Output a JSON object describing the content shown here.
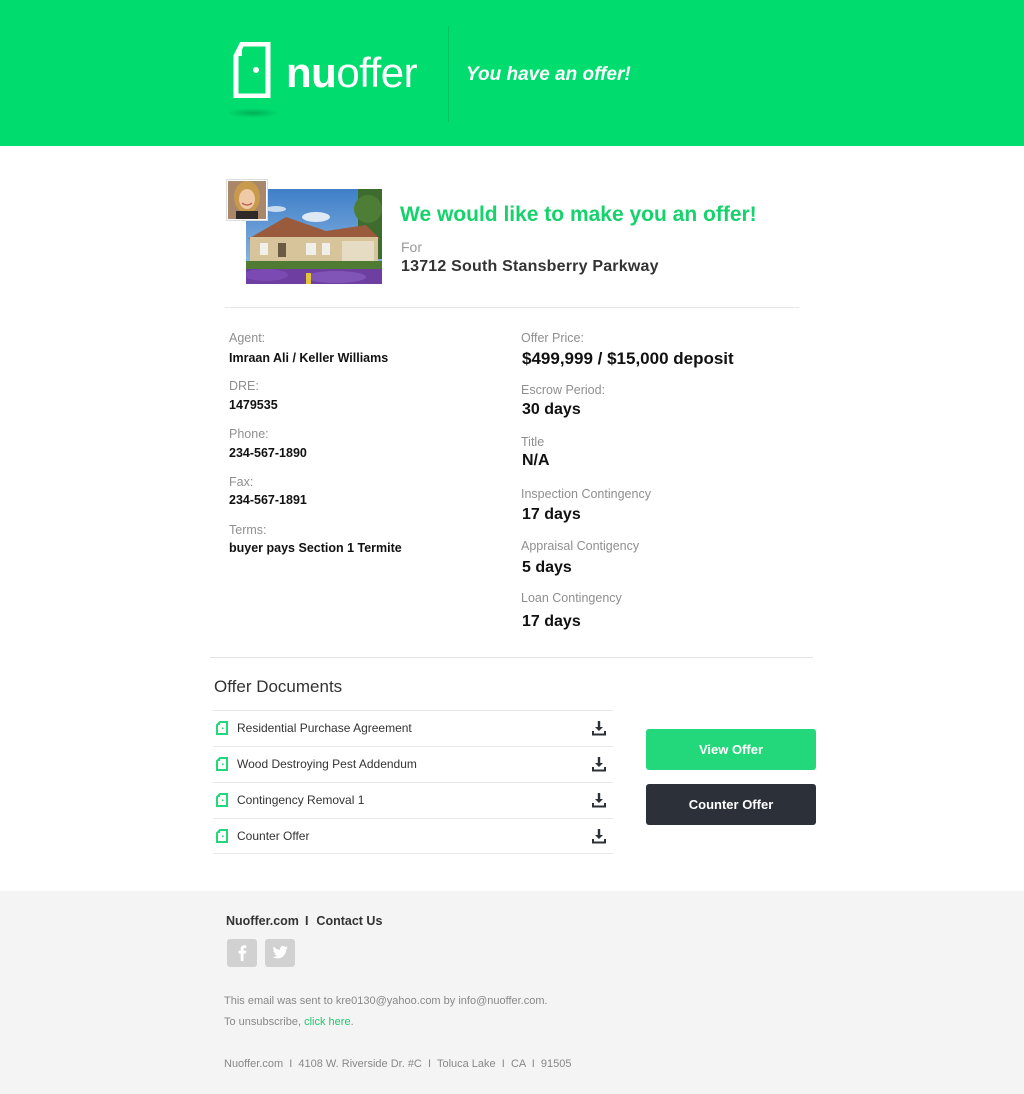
{
  "header": {
    "logo_bold": "nu",
    "logo_light": "offer",
    "tagline": "You have an offer!",
    "brand_color": "#00dd6e"
  },
  "hero": {
    "title": "We would like to make you an offer!",
    "for_label": "For",
    "address": "13712 South Stansberry Parkway"
  },
  "details": {
    "left": [
      {
        "label": "Agent:",
        "value": "Imraan Ali / Keller Williams"
      },
      {
        "label": "DRE:",
        "value": "1479535"
      },
      {
        "label": "Phone:",
        "value": "234-567-1890"
      },
      {
        "label": "Fax:",
        "value": "234-567-1891"
      },
      {
        "label": "Terms:",
        "value": "buyer pays Section 1 Termite"
      }
    ],
    "right": [
      {
        "label": "Offer Price:",
        "value": "$499,999 / $15,000 deposit"
      },
      {
        "label": "Escrow Period:",
        "value": "30 days"
      },
      {
        "label": "Title",
        "value": "N/A"
      },
      {
        "label": "Inspection Contingency",
        "value": "17 days"
      },
      {
        "label": "Appraisal Contigency",
        "value": "5 days"
      },
      {
        "label": "Loan Contingency",
        "value": "17 days"
      }
    ]
  },
  "documents": {
    "title": "Offer Documents",
    "items": [
      {
        "name": "Residential Purchase Agreement",
        "icon": "document-icon",
        "action": "download-icon"
      },
      {
        "name": "Wood Destroying Pest Addendum",
        "icon": "document-icon",
        "action": "download-icon"
      },
      {
        "name": "Contingency Removal 1",
        "icon": "document-icon",
        "action": "download-icon"
      },
      {
        "name": "Counter Offer",
        "icon": "document-icon",
        "action": "download-icon"
      }
    ]
  },
  "actions": {
    "view_offer": "View Offer",
    "counter_offer": "Counter Offer",
    "view_color": "#23d87a",
    "counter_color": "#2c3038"
  },
  "footer": {
    "link_site": "Nuoffer.com",
    "separator": "I",
    "link_contact": "Contact Us",
    "social": [
      "facebook-icon",
      "twitter-icon"
    ],
    "sent_text": "This email was sent to kre0130@yahoo.com by info@nuoffer.com.",
    "unsub_prefix": "To unsubscribe, ",
    "unsub_link": "click here",
    "unsub_suffix": ".",
    "address": "Nuoffer.com  I  4108 W. Riverside Dr. #C  I  Toluca Lake  I  CA  I  91505"
  }
}
